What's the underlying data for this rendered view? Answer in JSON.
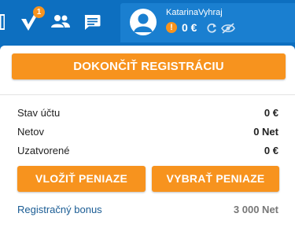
{
  "topbar": {
    "notification_count": "1"
  },
  "account": {
    "username": "KatarinaVyhraj",
    "balance": "0 €"
  },
  "card": {
    "register_button": "DOKONČIŤ REGISTRÁCIU",
    "rows": [
      {
        "label": "Stav účtu",
        "value": "0 €"
      },
      {
        "label": "Netov",
        "value": "0 Net"
      },
      {
        "label": "Uzatvorené",
        "value": "0 €"
      }
    ],
    "deposit_button": "VLOŽIŤ PENIAZE",
    "withdraw_button": "VYBRAŤ PENIAZE",
    "bonus_label": "Registračný bonus",
    "bonus_value": "3 000 Net"
  },
  "colors": {
    "header_blue": "#0d6fc0",
    "accent_orange": "#f7931e",
    "link_blue": "#1a5c94"
  },
  "icons": [
    "menu-edge-icon",
    "check-icon",
    "users-icon",
    "chat-icon",
    "user-avatar-icon",
    "warning-icon",
    "refresh-icon",
    "eye-off-icon"
  ]
}
